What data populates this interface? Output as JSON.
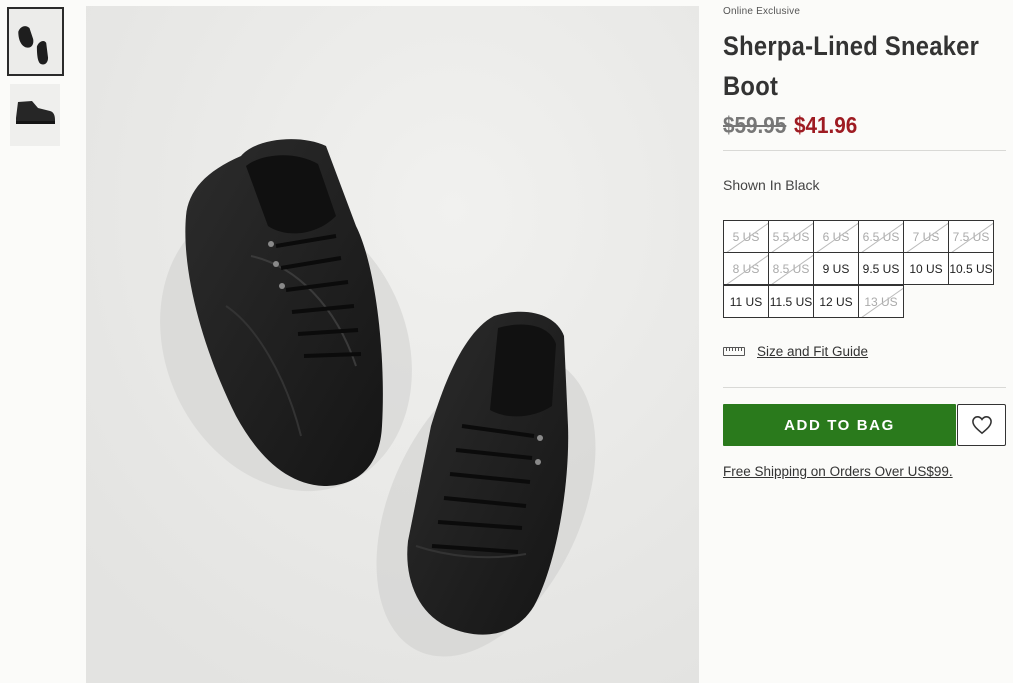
{
  "product": {
    "eyebrow": "Online Exclusive",
    "title": "Sherpa-Lined Sneaker Boot",
    "price_original": "$59.95",
    "price_sale": "$41.96",
    "shown_in": "Shown In Black"
  },
  "gallery": {
    "thumbnails": [
      {
        "name": "top-view",
        "selected": true
      },
      {
        "name": "side-view",
        "selected": false
      }
    ]
  },
  "sizes": [
    {
      "label": "5 US",
      "available": false
    },
    {
      "label": "5.5 US",
      "available": false
    },
    {
      "label": "6 US",
      "available": false
    },
    {
      "label": "6.5 US",
      "available": false
    },
    {
      "label": "7 US",
      "available": false
    },
    {
      "label": "7.5 US",
      "available": false
    },
    {
      "label": "8 US",
      "available": false
    },
    {
      "label": "8.5 US",
      "available": false
    },
    {
      "label": "9 US",
      "available": true
    },
    {
      "label": "9.5 US",
      "available": true
    },
    {
      "label": "10 US",
      "available": true
    },
    {
      "label": "10.5 US",
      "available": true
    },
    {
      "label": "11 US",
      "available": true
    },
    {
      "label": "11.5 US",
      "available": true
    },
    {
      "label": "12 US",
      "available": true
    },
    {
      "label": "13 US",
      "available": false
    }
  ],
  "size_guide": {
    "label": "Size and Fit Guide",
    "icon": "ruler-icon"
  },
  "actions": {
    "add_to_bag": "ADD TO BAG",
    "wishlist_icon": "heart-icon"
  },
  "shipping_note": "Free Shipping on Orders Over US$99.",
  "colors": {
    "sale_price": "#9e1b22",
    "add_to_bag_bg": "#2a7a1c"
  }
}
